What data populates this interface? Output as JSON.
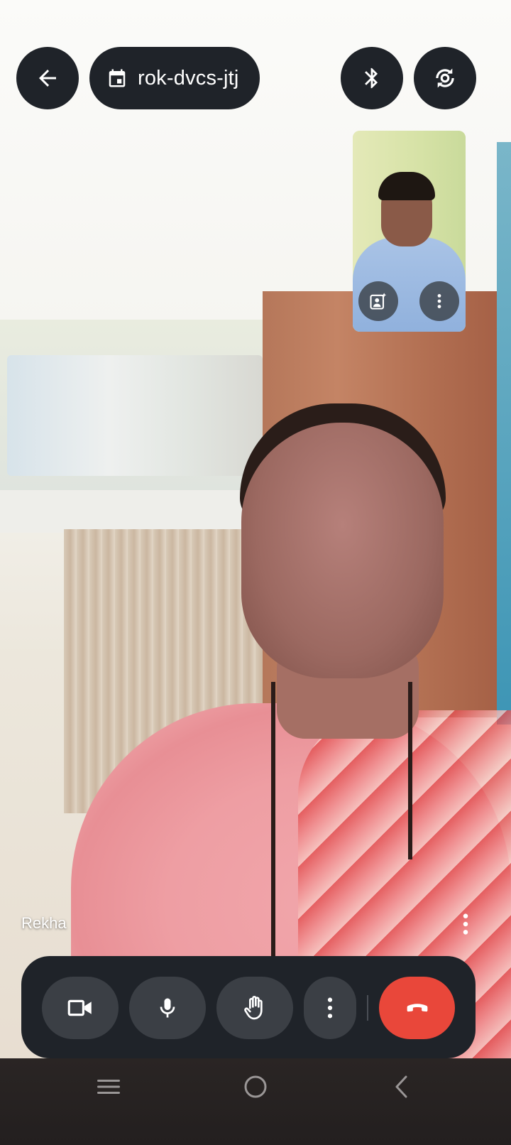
{
  "meeting": {
    "code": "rok-dvcs-jtj"
  },
  "participant": {
    "name": "Rekha"
  },
  "colors": {
    "bar_background": "#1f2329",
    "button_background": "#3b3f45",
    "end_call": "#e9473a",
    "icon": "#ffffff"
  },
  "icons": {
    "back": "arrow-left-icon",
    "calendar": "calendar-icon",
    "bluetooth": "bluetooth-icon",
    "switch_camera": "switch-camera-icon",
    "effects": "portrait-effects-icon",
    "more": "more-vert-icon",
    "camera": "videocam-icon",
    "microphone": "mic-icon",
    "raise_hand": "raise-hand-icon",
    "end_call": "call-end-icon",
    "recents": "recents-icon",
    "home": "home-icon",
    "nav_back": "nav-back-icon"
  }
}
